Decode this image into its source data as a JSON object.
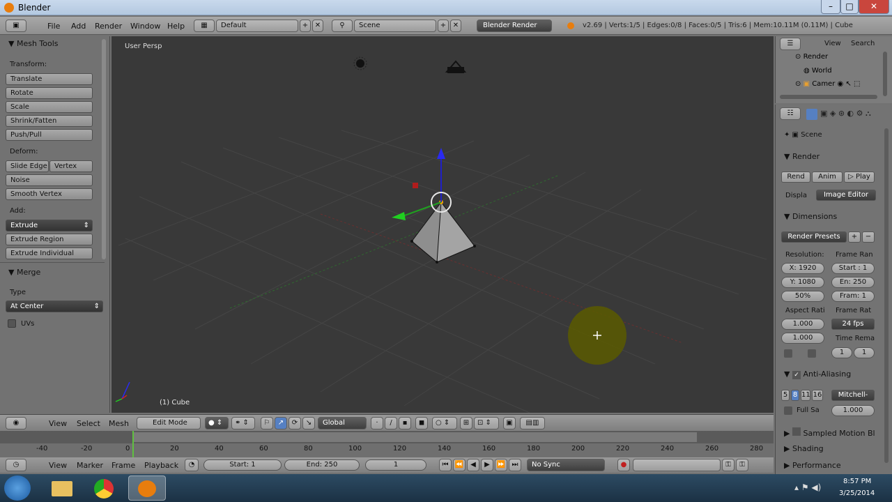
{
  "window": {
    "title": "Blender"
  },
  "info_header": {
    "menus": [
      "File",
      "Add",
      "Render",
      "Window",
      "Help"
    ],
    "layout": "Default",
    "scene": "Scene",
    "engine": "Blender Render",
    "stats": "v2.69 | Verts:1/5 | Edges:0/8 | Faces:0/5 | Tris:6 | Mem:10.11M (0.11M) | Cube"
  },
  "tools": {
    "header": "Mesh Tools",
    "transform_label": "Transform:",
    "transform": [
      "Translate",
      "Rotate",
      "Scale",
      "Shrink/Fatten",
      "Push/Pull"
    ],
    "deform_label": "Deform:",
    "deform_a": "Slide Edge",
    "deform_b": "Vertex",
    "deform": [
      "Noise",
      "Smooth Vertex"
    ],
    "add_label": "Add:",
    "extrude": "Extrude",
    "add": [
      "Extrude Region",
      "Extrude Individual"
    ],
    "merge_header": "Merge",
    "type_label": "Type",
    "type_value": "At Center",
    "uvs_label": "UVs"
  },
  "viewport": {
    "view_label": "User Persp",
    "object_label": "(1) Cube"
  },
  "view_header": {
    "menus": [
      "View",
      "Select",
      "Mesh"
    ],
    "mode": "Edit Mode",
    "orientation": "Global"
  },
  "timeline": {
    "ticks": [
      "-40",
      "-20",
      "0",
      "20",
      "40",
      "60",
      "80",
      "100",
      "120",
      "140",
      "160",
      "180",
      "200",
      "220",
      "240",
      "260",
      "280"
    ],
    "menus": [
      "View",
      "Marker",
      "Frame",
      "Playback"
    ],
    "start": "Start: 1",
    "end": "End: 250",
    "current": "1",
    "sync": "No Sync"
  },
  "outliner": {
    "view": "View",
    "search": "Search",
    "items": [
      "Render",
      "World",
      "Camer"
    ]
  },
  "properties": {
    "scene": "Scene",
    "render_header": "Render",
    "render_btn": "Rend",
    "anim_btn": "Anim",
    "play_btn": "Play",
    "display_label": "Displa",
    "display_value": "Image Editor",
    "dimensions_header": "Dimensions",
    "presets": "Render Presets",
    "resolution_label": "Resolution:",
    "res_x": "X: 1920",
    "res_y": "Y: 1080",
    "res_pct": "50%",
    "frame_range_label": "Frame Ran",
    "frame_start": "Start : 1",
    "frame_end": "En: 250",
    "frame_step": "Fram: 1",
    "aspect_label": "Aspect Rati",
    "aspect_x": "1.000",
    "aspect_y": "1.000",
    "frame_rate_label": "Frame Rat",
    "fps": "24 fps",
    "time_remap_label": "Time Rema",
    "remap_a": "1",
    "remap_b": "1",
    "aa_header": "Anti-Aliasing",
    "aa_samples": [
      "5",
      "8",
      "11",
      "16"
    ],
    "aa_filter": "Mitchell-",
    "full_sample": "Full Sa",
    "aa_size": "1.000",
    "motion_blur": "Sampled Motion Bl",
    "shading": "Shading",
    "performance": "Performance"
  },
  "taskbar": {
    "time": "8:57 PM",
    "date": "3/25/2014"
  },
  "colors": {
    "viewport_bg": "#393939",
    "panel_bg": "#727272",
    "selected": "#3d3d3d",
    "accent_blue": "#5680c2"
  }
}
